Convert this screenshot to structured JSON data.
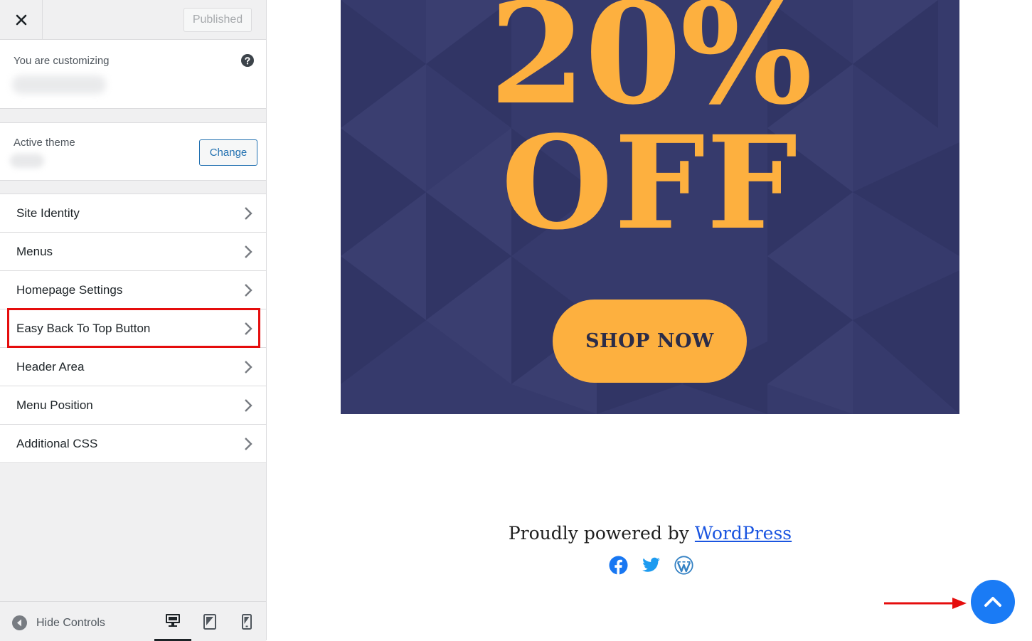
{
  "topbar": {
    "close_icon": "close-icon",
    "publish_label": "Published"
  },
  "customizing": {
    "label": "You are customizing",
    "help_icon": "question-circle-icon"
  },
  "active_theme": {
    "label": "Active theme",
    "change_label": "Change"
  },
  "panels": [
    {
      "label": "Site Identity"
    },
    {
      "label": "Menus"
    },
    {
      "label": "Homepage Settings"
    },
    {
      "label": "Easy Back To Top Button",
      "highlighted": true
    },
    {
      "label": "Header Area"
    },
    {
      "label": "Menu Position"
    },
    {
      "label": "Additional CSS"
    }
  ],
  "footer": {
    "hide_controls_label": "Hide Controls",
    "devices": [
      "desktop",
      "tablet",
      "mobile"
    ],
    "active_device": "desktop"
  },
  "preview": {
    "promo_line1": "20%",
    "promo_line2": "OFF",
    "shop_label": "SHOP NOW",
    "powered_prefix": "Proudly powered by",
    "powered_link": "WordPress",
    "social_icons": [
      "facebook-icon",
      "twitter-icon",
      "wordpress-icon"
    ],
    "back_to_top_icon": "chevron-up-icon"
  },
  "colors": {
    "banner_bg": "#363a6c",
    "promo": "#fdb03f",
    "back_to_top": "#1a7bf5",
    "highlight": "#e50d0d",
    "link": "#1a55e0",
    "wp_accent": "#2271b1"
  }
}
